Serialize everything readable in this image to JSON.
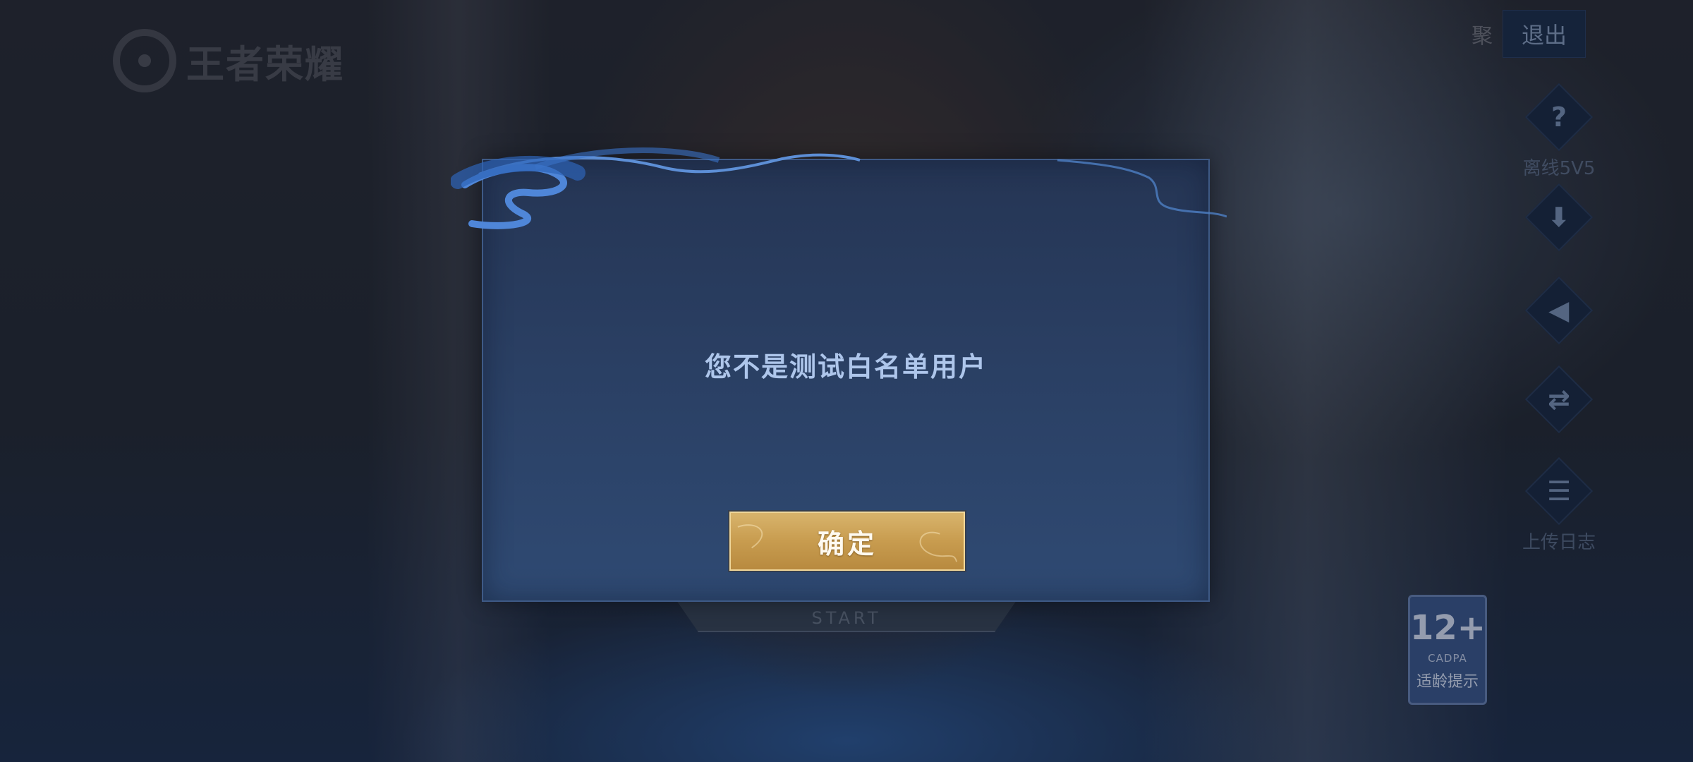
{
  "app": {
    "logo_text": "王者荣耀"
  },
  "topbar": {
    "account_label": "聚",
    "exit_label": "退出"
  },
  "side_tools": [
    {
      "icon": "question-icon",
      "glyph": "?",
      "label": "离线5V5"
    },
    {
      "icon": "download-icon",
      "glyph": "⬇",
      "label": ""
    },
    {
      "icon": "speaker-icon",
      "glyph": "◀",
      "label": ""
    },
    {
      "icon": "switch-account-icon",
      "glyph": "⇄",
      "label": ""
    },
    {
      "icon": "clipboard-icon",
      "glyph": "☰",
      "label": "上传日志"
    }
  ],
  "start_button": {
    "label": "START"
  },
  "age_rating": {
    "age": "12+",
    "org": "CADPA",
    "tip": "适龄提示"
  },
  "dialog": {
    "message": "您不是测试白名单用户",
    "ok_label": "确定"
  },
  "colors": {
    "dialog_bg": "#2a3f63",
    "dialog_text": "#aec6eb",
    "ok_button": "#c89c4f",
    "exit_button": "#1d2e4e"
  }
}
